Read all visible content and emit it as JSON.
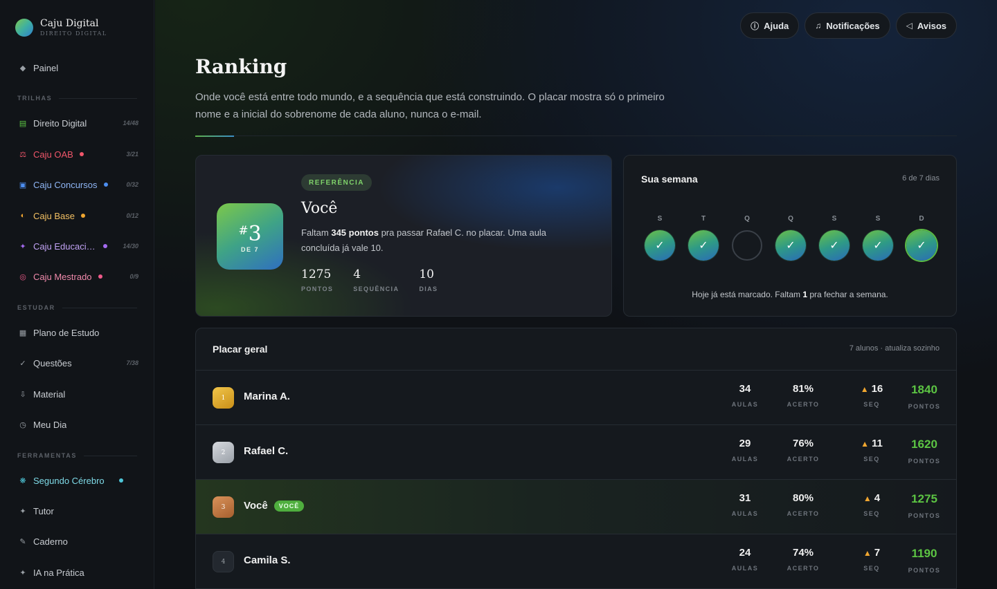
{
  "brand": {
    "name": "Caju Digital",
    "subtitle": "DIREITO DIGITAL"
  },
  "sidebar": {
    "panel": {
      "label": "Painel",
      "icon": "diamond-icon"
    },
    "sections": {
      "trilhas": "TRILHAS",
      "estudar": "ESTUDAR",
      "ferramentas": "FERRAMENTAS"
    },
    "trilhas": [
      {
        "label": "Direito Digital",
        "count": "14/48",
        "icon": "book-icon",
        "color": "#5cc443"
      },
      {
        "label": "Caju OAB",
        "count": "3/21",
        "icon": "scale-icon",
        "color": "#f0566a",
        "dot": "#f0566a"
      },
      {
        "label": "Caju Concursos",
        "count": "0/32",
        "icon": "building-icon",
        "color": "#4d8ef0",
        "dot": "#4d8ef0"
      },
      {
        "label": "Caju Base",
        "count": "0/12",
        "icon": "half-circle-icon",
        "color": "#f0a630",
        "dot": "#f0a630"
      },
      {
        "label": "Caju Educacional",
        "count": "14/30",
        "icon": "sparkle-icon",
        "color": "#a46af0",
        "dot": "#a46af0"
      },
      {
        "label": "Caju Mestrado",
        "count": "0/9",
        "icon": "target-icon",
        "color": "#f05a8a",
        "dot": "#f05a8a"
      }
    ],
    "estudar": [
      {
        "label": "Plano de Estudo",
        "count": "",
        "icon": "grid-icon"
      },
      {
        "label": "Questões",
        "count": "7/38",
        "icon": "check-icon"
      },
      {
        "label": "Material",
        "count": "",
        "icon": "download-icon"
      },
      {
        "label": "Meu Dia",
        "count": "",
        "icon": "clock-icon"
      }
    ],
    "ferramentas": [
      {
        "label": "Segundo Cérebro",
        "icon": "brain-icon",
        "color": "#4ec6d8",
        "dot": "#4ec6d8"
      },
      {
        "label": "Tutor",
        "icon": "star-icon"
      },
      {
        "label": "Caderno",
        "icon": "pencil-icon"
      },
      {
        "label": "IA na Prática",
        "icon": "star-icon"
      }
    ]
  },
  "topbar": {
    "help": "Ajuda",
    "notifications": "Notificações",
    "announcements": "Avisos"
  },
  "page": {
    "title": "Ranking",
    "description": "Onde você está entre todo mundo, e a sequência que está construindo. O placar mostra só o primeiro nome e a inicial do sobrenome de cada aluno, nunca o e-mail."
  },
  "hero": {
    "rank": "3",
    "rank_of": "DE 7",
    "tag": "REFERÊNCIA",
    "name": "Você",
    "msg_pre": "Faltam ",
    "msg_bold": "345 pontos",
    "msg_post": " pra passar Rafael C. no placar. Uma aula concluída já vale 10.",
    "stats": [
      {
        "value": "1275",
        "label": "PONTOS"
      },
      {
        "value": "4",
        "label": "SEQUÊNCIA"
      },
      {
        "value": "10",
        "label": "DIAS"
      }
    ]
  },
  "week": {
    "title": "Sua semana",
    "count": "6 de 7 dias",
    "days": [
      {
        "letter": "S",
        "done": true
      },
      {
        "letter": "T",
        "done": true
      },
      {
        "letter": "Q",
        "done": false
      },
      {
        "letter": "Q",
        "done": true
      },
      {
        "letter": "S",
        "done": true
      },
      {
        "letter": "S",
        "done": true
      },
      {
        "letter": "D",
        "done": true,
        "today": true
      }
    ],
    "check": "✓",
    "foot_pre": "Hoje já está marcado. Faltam ",
    "foot_bold": "1",
    "foot_post": " pra fechar a semana."
  },
  "board": {
    "title": "Placar geral",
    "meta": "7 alunos · atualiza sozinho",
    "labels": {
      "aulas": "AULAS",
      "acerto": "ACERTO",
      "seq": "SEQ",
      "pontos": "PONTOS"
    },
    "you_tag": "VOCÊ",
    "rows": [
      {
        "pos": "1",
        "name": "Marina A.",
        "aulas": "34",
        "acerto": "81%",
        "seq": "16",
        "pontos": "1840",
        "me": false
      },
      {
        "pos": "2",
        "name": "Rafael C.",
        "aulas": "29",
        "acerto": "76%",
        "seq": "11",
        "pontos": "1620",
        "me": false
      },
      {
        "pos": "3",
        "name": "Você",
        "aulas": "31",
        "acerto": "80%",
        "seq": "4",
        "pontos": "1275",
        "me": true
      },
      {
        "pos": "4",
        "name": "Camila S.",
        "aulas": "24",
        "acerto": "74%",
        "seq": "7",
        "pontos": "1190",
        "me": false
      }
    ]
  }
}
